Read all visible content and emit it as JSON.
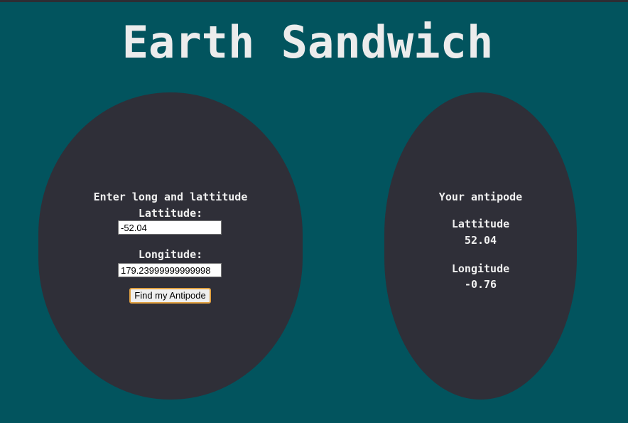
{
  "app": {
    "title": "Earth Sandwich"
  },
  "form": {
    "heading": "Enter long and lattitude",
    "latitude_label": "Lattitude:",
    "latitude_value": "-52.04",
    "longitude_label": "Longitude:",
    "longitude_value": "179.23999999999998",
    "submit_label": "Find my Antipode"
  },
  "result": {
    "heading": "Your antipode",
    "latitude_label": "Lattitude",
    "latitude_value": "52.04",
    "longitude_label": "Longitude",
    "longitude_value": "-0.76"
  },
  "colors": {
    "background": "#02545e",
    "panel": "#2f2f38",
    "button_border": "#e0a040",
    "text": "#f0f0f0"
  }
}
